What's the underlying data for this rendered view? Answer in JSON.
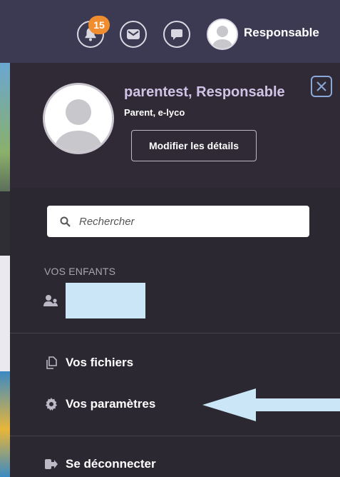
{
  "topbar": {
    "notifications_count": "15",
    "user_label": "Responsable",
    "icons": [
      "bell-icon",
      "mail-icon",
      "chat-icon",
      "avatar"
    ]
  },
  "profile": {
    "name": "parentest, Responsable",
    "role": "Parent, e-lyco",
    "edit_label": "Modifier les détails"
  },
  "search": {
    "placeholder": "Rechercher"
  },
  "children": {
    "section_label": "VOS ENFANTS"
  },
  "menu": {
    "files": "Vos fichiers",
    "settings": "Vos paramètres",
    "logout": "Se déconnecter"
  },
  "colors": {
    "topbar": "#3c3a52",
    "drawer": "#2c2831",
    "badge": "#f08d2e",
    "arrow": "#cbe6f6",
    "name": "#cfc4e6"
  }
}
